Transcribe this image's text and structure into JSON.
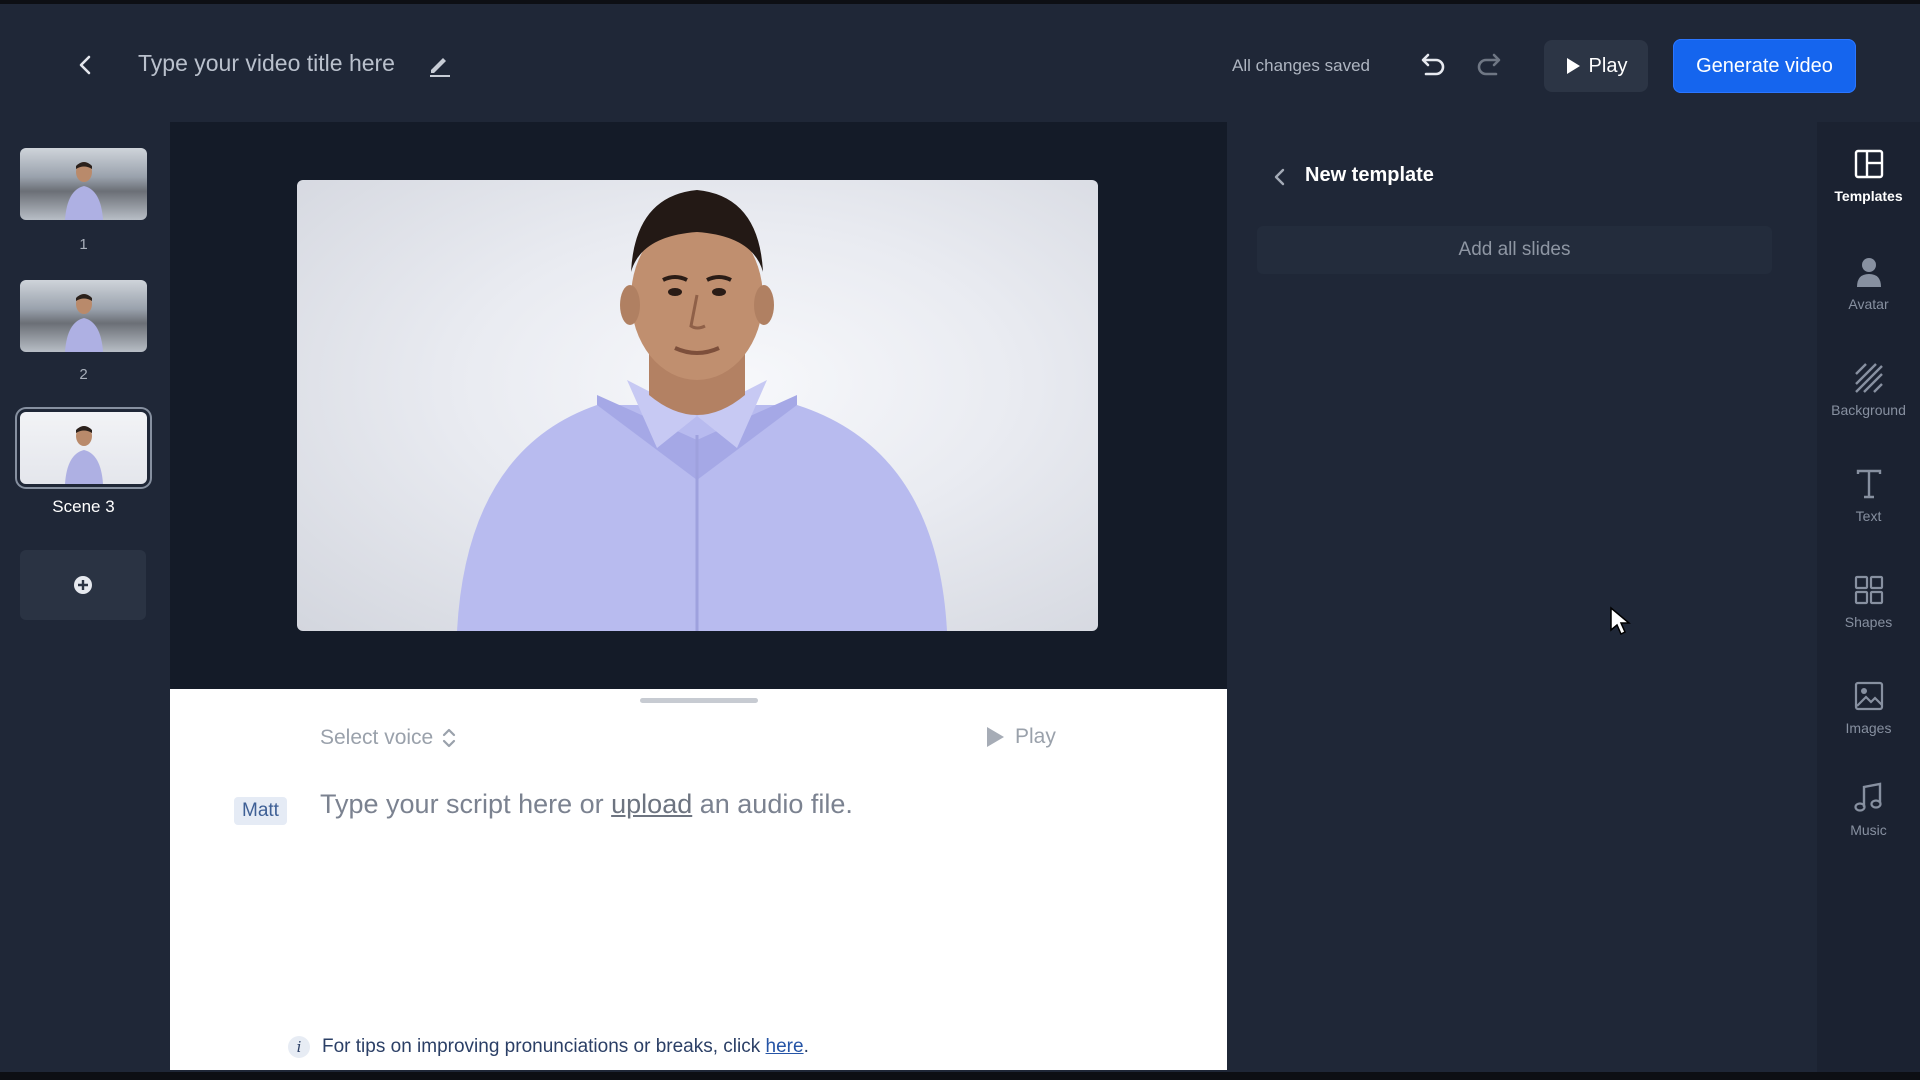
{
  "header": {
    "title": "Type your video title here",
    "status": "All changes saved",
    "play_label": "Play",
    "generate_label": "Generate video"
  },
  "slides": {
    "items": [
      {
        "label": "1"
      },
      {
        "label": "2"
      },
      {
        "label": "Scene 3",
        "selected": true
      }
    ]
  },
  "editor": {
    "select_voice": "Select voice",
    "play_label": "Play",
    "voice_tag": "Matt",
    "script_prefix": "Type your script here or",
    "upload_link": "upload",
    "script_suffix": "an audio file.",
    "tips_text": "For tips on improving pronunciations or breaks, click",
    "tips_link": "here",
    "tips_end": "."
  },
  "templates_panel": {
    "title": "New template",
    "add_all": "Add all slides"
  },
  "toolbar": {
    "items": [
      {
        "label": "Templates",
        "icon": "templates-icon",
        "active": true
      },
      {
        "label": "Avatar",
        "icon": "avatar-icon"
      },
      {
        "label": "Background",
        "icon": "background-icon"
      },
      {
        "label": "Text",
        "icon": "text-icon"
      },
      {
        "label": "Shapes",
        "icon": "shapes-icon"
      },
      {
        "label": "Images",
        "icon": "images-icon"
      },
      {
        "label": "Music",
        "icon": "music-icon"
      }
    ]
  },
  "colors": {
    "primary": "#1565ee",
    "background": "#1f2737",
    "canvas": "#141b28"
  }
}
